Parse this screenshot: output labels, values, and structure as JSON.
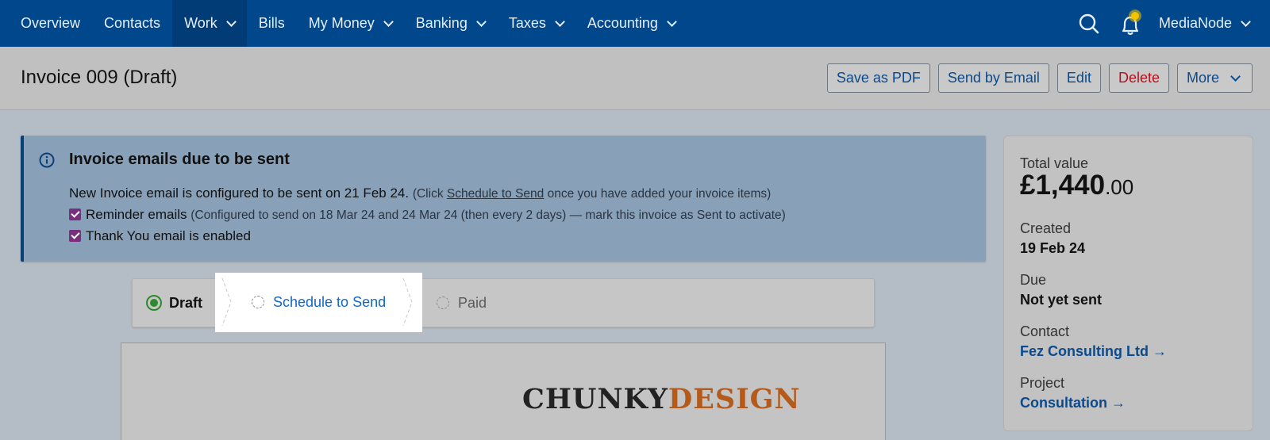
{
  "nav": {
    "items": [
      {
        "label": "Overview",
        "dropdown": false
      },
      {
        "label": "Contacts",
        "dropdown": false
      },
      {
        "label": "Work",
        "dropdown": true,
        "active": true
      },
      {
        "label": "Bills",
        "dropdown": false
      },
      {
        "label": "My Money",
        "dropdown": true
      },
      {
        "label": "Banking",
        "dropdown": true
      },
      {
        "label": "Taxes",
        "dropdown": true
      },
      {
        "label": "Accounting",
        "dropdown": true
      }
    ],
    "account_name": "MediaNode",
    "icons": [
      "search-icon",
      "bell-icon"
    ]
  },
  "header": {
    "title": "Invoice 009 (Draft)",
    "buttons": {
      "save_pdf": "Save as PDF",
      "send_email": "Send by Email",
      "edit": "Edit",
      "delete": "Delete",
      "more": "More"
    }
  },
  "notice": {
    "title": "Invoice emails due to be sent",
    "line1_main": "New Invoice email is configured to be sent on 21 Feb 24.",
    "line1_pre": "(Click ",
    "line1_link": "Schedule to Send",
    "line1_post": " once you have added your invoice items)",
    "reminder_label": "Reminder emails",
    "reminder_note": "(Configured to send on 18 Mar 24 and 24 Mar 24 (then every 2 days) — mark this invoice as Sent to activate)",
    "reminder_checked": true,
    "thankyou_label": "Thank You email is enabled",
    "thankyou_checked": true
  },
  "stepper": {
    "draft": "Draft",
    "schedule": "Schedule to Send",
    "paid": "Paid",
    "current": "Draft"
  },
  "preview": {
    "logo_part1": "CHUNKY",
    "logo_part2": "DESIGN"
  },
  "summary": {
    "total_label": "Total value",
    "total_main": "£1,440",
    "total_cents": ".00",
    "created_label": "Created",
    "created_value": "19 Feb 24",
    "due_label": "Due",
    "due_value": "Not yet sent",
    "contact_label": "Contact",
    "contact_value": "Fez Consulting Ltd →",
    "project_label": "Project",
    "project_value": "Consultation →"
  },
  "colors": {
    "nav_bg": "#01478c",
    "link": "#0b4a8c",
    "danger": "#b3121f",
    "check": "#7a2f7e",
    "done_green": "#2f8a2f"
  }
}
